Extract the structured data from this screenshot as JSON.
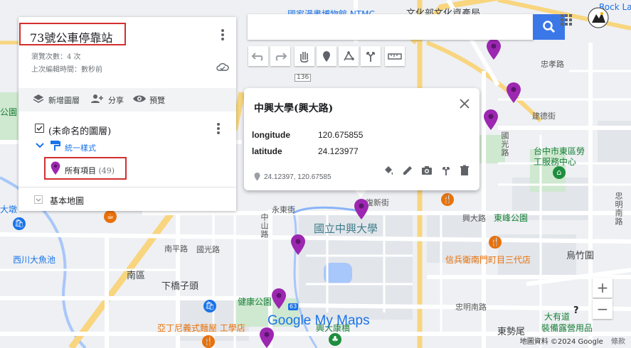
{
  "map_title": "73號公車停靠站",
  "views_text": "瀏覽次數：4 次",
  "last_edit_text": "上次編輯時間：數秒前",
  "toolbar": {
    "add_layer": "新增圖層",
    "share": "分享",
    "preview": "預覽"
  },
  "layer": {
    "name": "(未命名的圖層)",
    "style": "統一樣式",
    "items_label": "所有項目",
    "items_count": "(49)"
  },
  "base_map": "基本地圖",
  "search": {
    "value": "",
    "placeholder": ""
  },
  "info_card": {
    "title": "中興大學(興大路)",
    "fields": [
      {
        "key": "longitude",
        "value": "120.675855"
      },
      {
        "key": "latitude",
        "value": "24.123977"
      }
    ],
    "coords": "24.12397, 120.67585"
  },
  "map_labels": {
    "national_museum": "國家漫畫博物館 NTMC",
    "culture_museum": "文化部文化資產局",
    "nchu": "國立中興大學",
    "south_district": "南區",
    "xiaqiaozitou": "下橋子頭",
    "wuzhuzhuang": "烏竹圍",
    "east_district_office": "台中市東區勞工服務中心",
    "dongfeng_park": "東峰公園",
    "xinbing_street": "信兵衛南門町目三代店",
    "health_park": "健康公園",
    "yanan": "亞丁尼義式麵屋 工學店",
    "xingda_kangshi": "興大康橋",
    "datong_rd": "大有道",
    "zhuangbei": "裝備露營用品",
    "rock_la": "Rock LaL",
    "park_left": "公園",
    "dadun": "大墩",
    "ximoda": "西川大魚池",
    "dongshi": "東勢尾"
  },
  "road_labels": {
    "fuxin": "復新街",
    "yongdong": "永東街",
    "xingda": "興大路",
    "nanxing": "南平路",
    "xiaoguo": "國光路",
    "zhongshan": "中山路",
    "jiande": "建德街",
    "zhongxiao": "忠孝路",
    "zhongming": "忠明南路",
    "zhongmingnan": "忠明南路",
    "guoguang": "國光路",
    "road136": "136",
    "road63": "63"
  },
  "bottom_bar": {
    "brand": "Google My Maps",
    "copyright": "地圖資料 ©2024 Google",
    "terms": "條款"
  },
  "zoom": {
    "in": "+",
    "out": "−"
  },
  "help": "?"
}
